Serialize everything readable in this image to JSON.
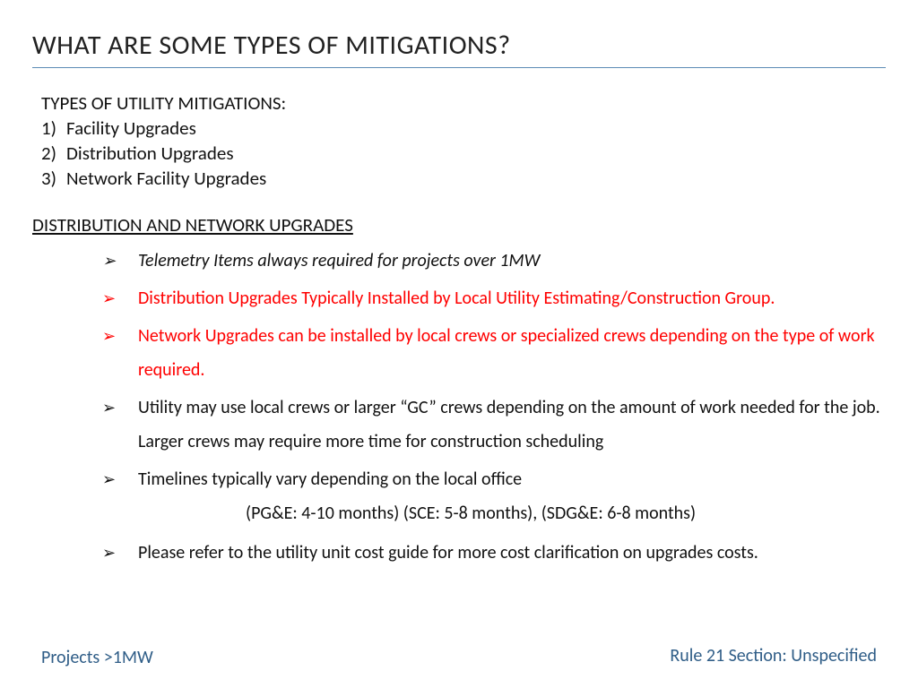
{
  "title": "WHAT ARE SOME TYPES OF MITIGATIONS?",
  "intro": {
    "heading": "TYPES OF UTILITY MITIGATIONS:",
    "items": [
      "Facility Upgrades",
      "Distribution Upgrades",
      "Network Facility Upgrades"
    ]
  },
  "section_heading": "DISTRIBUTION AND NETWORK UPGRADES",
  "bullets": [
    {
      "text": "Telemetry Items always required for projects over 1MW",
      "red": false,
      "italic": true
    },
    {
      "text": "Distribution Upgrades Typically Installed by Local Utility Estimating/Construction Group.",
      "red": true,
      "italic": false
    },
    {
      "text": "Network Upgrades can be installed by local crews or specialized crews depending on the type of work required.",
      "red": true,
      "italic": false
    },
    {
      "text": "Utility may use local crews or larger “GC” crews depending on the amount of work needed for the job. Larger crews may require more time for construction scheduling",
      "red": false,
      "italic": false
    },
    {
      "text": "Timelines typically vary depending on the local office",
      "red": false,
      "italic": false,
      "sub": "(PG&E: 4-10 months) (SCE: 5-8 months),  (SDG&E: 6-8 months)"
    },
    {
      "text": "Please refer to the utility unit cost guide for more cost clarification on upgrades costs.",
      "red": false,
      "italic": false
    }
  ],
  "footer": {
    "left": "Projects >1MW",
    "right": "Rule 21 Section: Unspecified"
  },
  "arrow_glyph": "➢"
}
